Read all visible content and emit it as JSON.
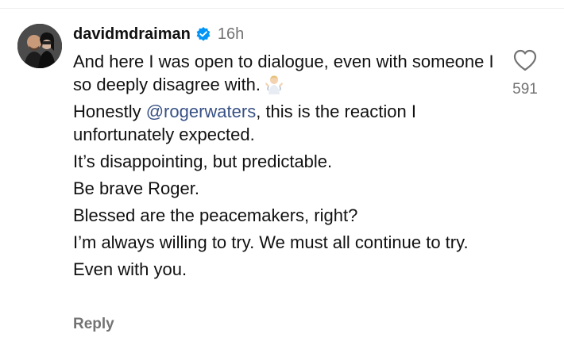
{
  "comment": {
    "username": "davidmdraiman",
    "timestamp": "16h",
    "lines": [
      "And here I was open to dialogue, even with someone I so deeply disagree with.",
      "Honestly",
      "@rogerwaters",
      ", this is the reaction I unfortunately expected.",
      "It’s disappointing, but predictable.",
      "Be brave Roger.",
      "Blessed are the peacemakers, right?",
      "I’m always willing to try. We must all continue to try.",
      "Even with you."
    ],
    "emoji_icon": "person-shrugging-emoji",
    "reply_label": "Reply",
    "like_count": "591",
    "like_icon": "heart-outline-icon"
  },
  "colors": {
    "mention": "#00376b",
    "verified": "#0095f6",
    "muted": "#737373"
  }
}
